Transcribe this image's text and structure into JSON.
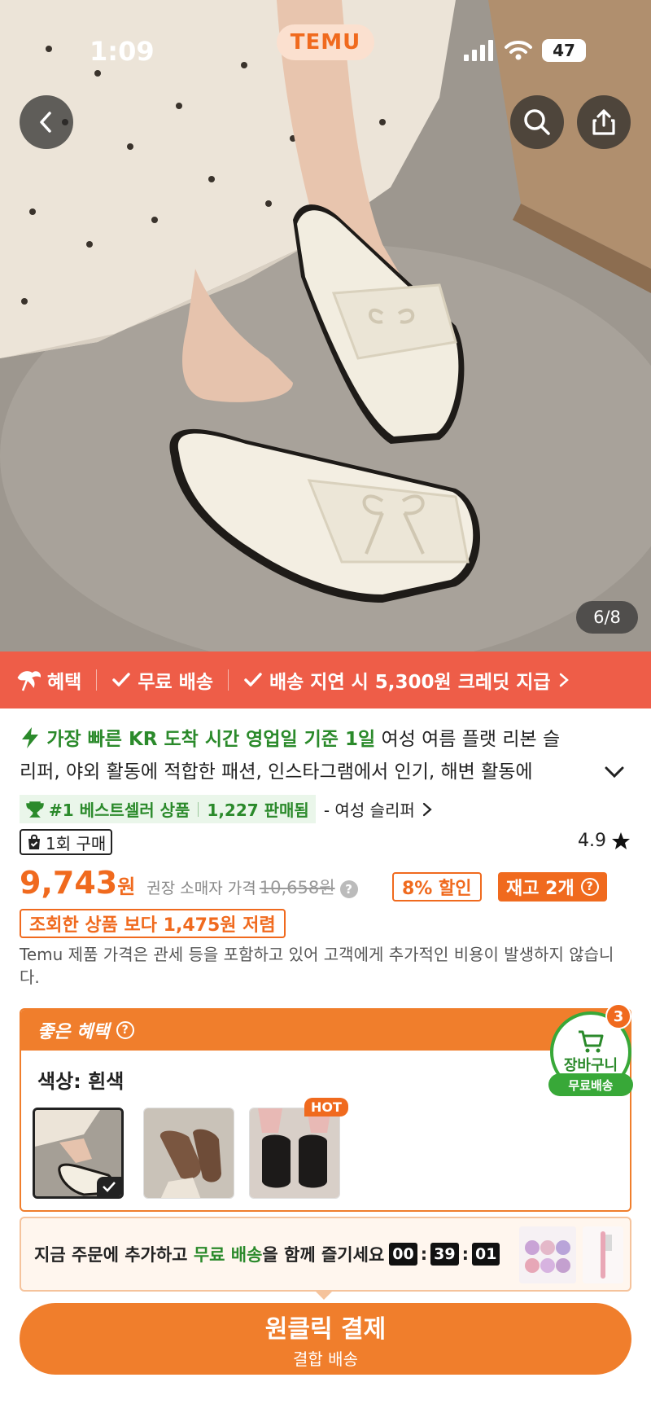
{
  "status": {
    "time": "1:09",
    "brand": "TEMU",
    "battery": "47"
  },
  "gallery": {
    "counter": "6/8"
  },
  "benefit_bar": {
    "label": "혜택",
    "free_shipping": "무료 배송",
    "delay_credit": "배송 지연 시 5,300원 크레딧 지급"
  },
  "product": {
    "fast_badge": "가장 빠른 KR 도착 시간 영업일 기준 1일",
    "title_line1": "여성 여름 플랫 리본 슬",
    "title_line2": "리퍼, 야외 활동에 적합한 패션, 인스타그램에서 인기, 해변 활동에",
    "bestseller": "#1 베스트셀러 상품",
    "sold": "1,227 판매됨",
    "category": "- 여성 슬리퍼",
    "purchase_badge": "1회 구매",
    "rating": "4.9"
  },
  "price": {
    "value": "9,743",
    "currency": "원",
    "rrp_label": "권장 소매자 가격",
    "rrp_value": "10,658원",
    "discount": "8% 할인",
    "stock": "재고 2개",
    "compare": "조회한 상품 보다 1,475원 저렴",
    "tax_note": "Temu 제품 가격은 관세 등을 포함하고 있어 고객에게 추가적인 비용이 발생하지 않습니다."
  },
  "good_benefit": {
    "header": "좋은 혜택",
    "color_label": "색상: 흰색",
    "hot": "HOT"
  },
  "cart": {
    "label": "장바구니",
    "count": "3",
    "free": "무료배송"
  },
  "promo": {
    "text_before": "지금 주문에 추가하고 ",
    "highlight": "무료 배송",
    "text_after": "을 함께 즐기세요",
    "timer": [
      "00",
      "39",
      "01"
    ]
  },
  "checkout": {
    "main": "원클릭 결제",
    "sub": "결합 배송"
  },
  "colors": {
    "accent": "#f07e2c",
    "benefit_red": "#ee5d48",
    "green": "#2b8a2b"
  }
}
